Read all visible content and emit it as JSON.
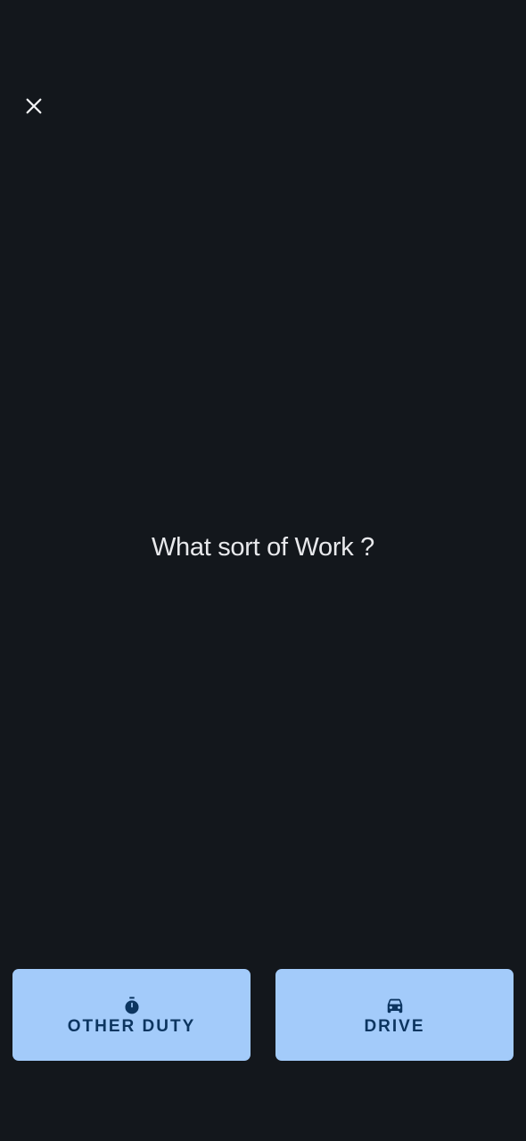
{
  "header": {
    "close_icon": "close-icon"
  },
  "main": {
    "question": "What sort of Work ?"
  },
  "actions": {
    "other_duty": {
      "label": "OTHER DUTY",
      "icon": "stopwatch-icon"
    },
    "drive": {
      "label": "DRIVE",
      "icon": "car-icon"
    }
  },
  "colors": {
    "background": "#13171c",
    "button_fill": "#a3cbfa",
    "button_text": "#0c3560",
    "text": "#e8e9ec"
  }
}
